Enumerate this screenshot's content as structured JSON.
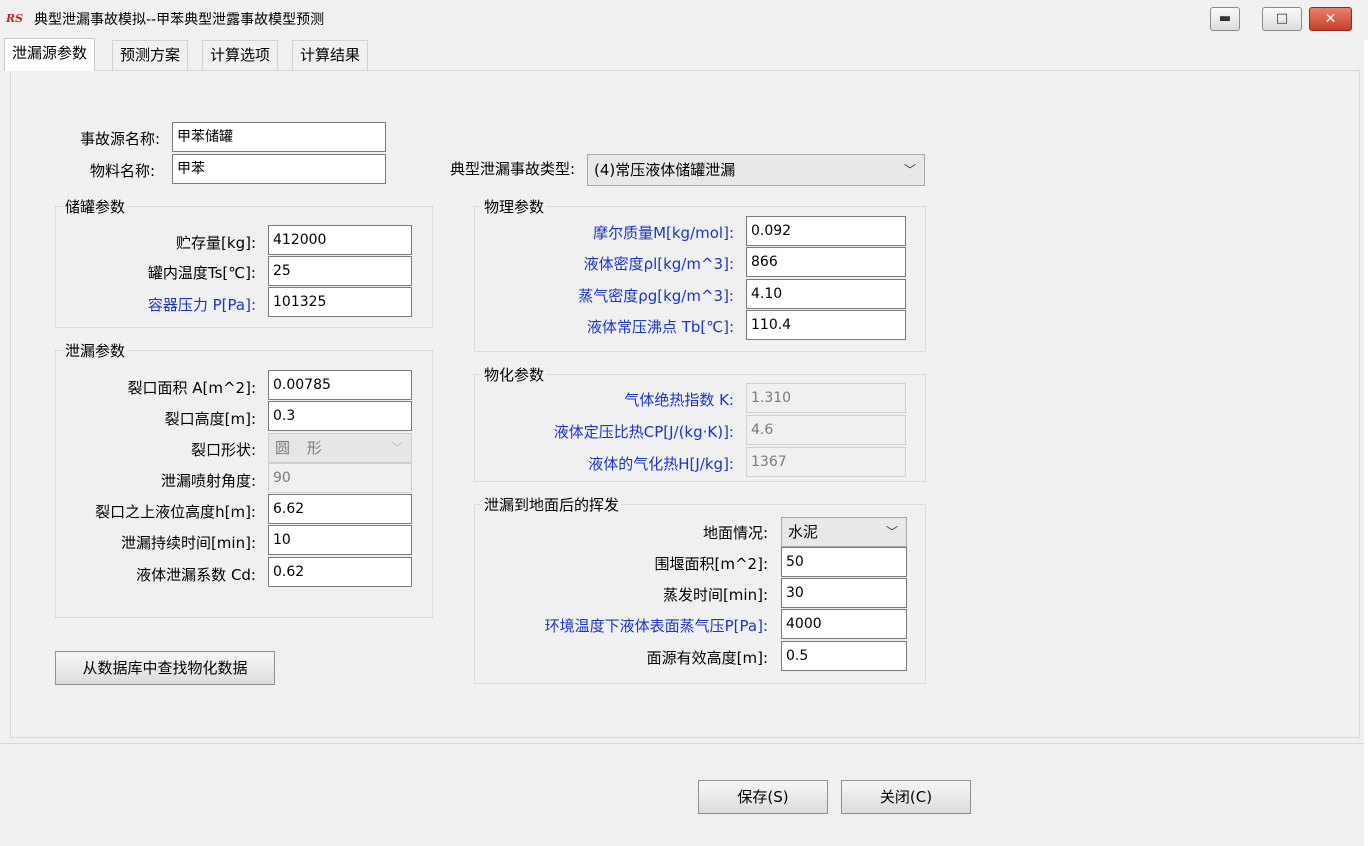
{
  "window": {
    "logo_text": "RS",
    "title": "典型泄漏事故模拟--甲苯典型泄露事故模型预测",
    "min_symbol": "▬",
    "max_symbol": "□",
    "close_symbol": "✕"
  },
  "tabs": [
    "泄漏源参数",
    "预测方案",
    "计算选项",
    "计算结果"
  ],
  "source": {
    "accident_name_label": "事故源名称:",
    "accident_name_value": "甲苯储罐",
    "material_label": "物料名称:",
    "material_value": "甲苯",
    "type_label": "典型泄漏事故类型:",
    "type_value": "(4)常压液体储罐泄漏"
  },
  "tank": {
    "title": "储罐参数",
    "storage_label": "贮存量[kg]:",
    "storage_value": "412000",
    "temp_label": "罐内温度Ts[℃]:",
    "temp_value": "25",
    "pressure_label": "容器压力 P[Pa]:",
    "pressure_value": "101325"
  },
  "leak": {
    "title": "泄漏参数",
    "area_label": "裂口面积 A[m^2]:",
    "area_value": "0.00785",
    "height_label": "裂口高度[m]:",
    "height_value": "0.3",
    "shape_label": "裂口形状:",
    "shape_value": "圆 形",
    "angle_label": "泄漏喷射角度:",
    "angle_value": "90",
    "level_label": "裂口之上液位高度h[m]:",
    "level_value": "6.62",
    "duration_label": "泄漏持续时间[min]:",
    "duration_value": "10",
    "coef_label": "液体泄漏系数 Cd:",
    "coef_value": "0.62"
  },
  "physical": {
    "title": "物理参数",
    "molar_label": "摩尔质量M[kg/mol]:",
    "molar_value": "0.092",
    "liq_density_label": "液体密度ρl[kg/m^3]:",
    "liq_density_value": "866",
    "vap_density_label": "蒸气密度ρg[kg/m^3]:",
    "vap_density_value": "4.10",
    "boiling_label": "液体常压沸点 Tb[℃]:",
    "boiling_value": "110.4"
  },
  "chem": {
    "title": "物化参数",
    "k_label": "气体绝热指数 K:",
    "k_value": "1.310",
    "cp_label": "液体定压比热CP[J/(kg·K)]:",
    "cp_value": "4.6",
    "h_label": "液体的气化热H[J/kg]:",
    "h_value": "1367"
  },
  "evap": {
    "title": "泄漏到地面后的挥发",
    "ground_label": "地面情况:",
    "ground_value": "水泥",
    "dike_label": "围堰面积[m^2]:",
    "dike_value": "50",
    "time_label": "蒸发时间[min]:",
    "time_value": "30",
    "vp_label": "环境温度下液体表面蒸气压P[Pa]:",
    "vp_value": "4000",
    "height_label": "面源有效高度[m]:",
    "height_value": "0.5"
  },
  "buttons": {
    "lookup": "从数据库中查找物化数据",
    "save": "保存(S)",
    "close": "关闭(C)"
  },
  "colors": {
    "blue_label": "#1c33c4",
    "close_button": "#c7402a"
  }
}
